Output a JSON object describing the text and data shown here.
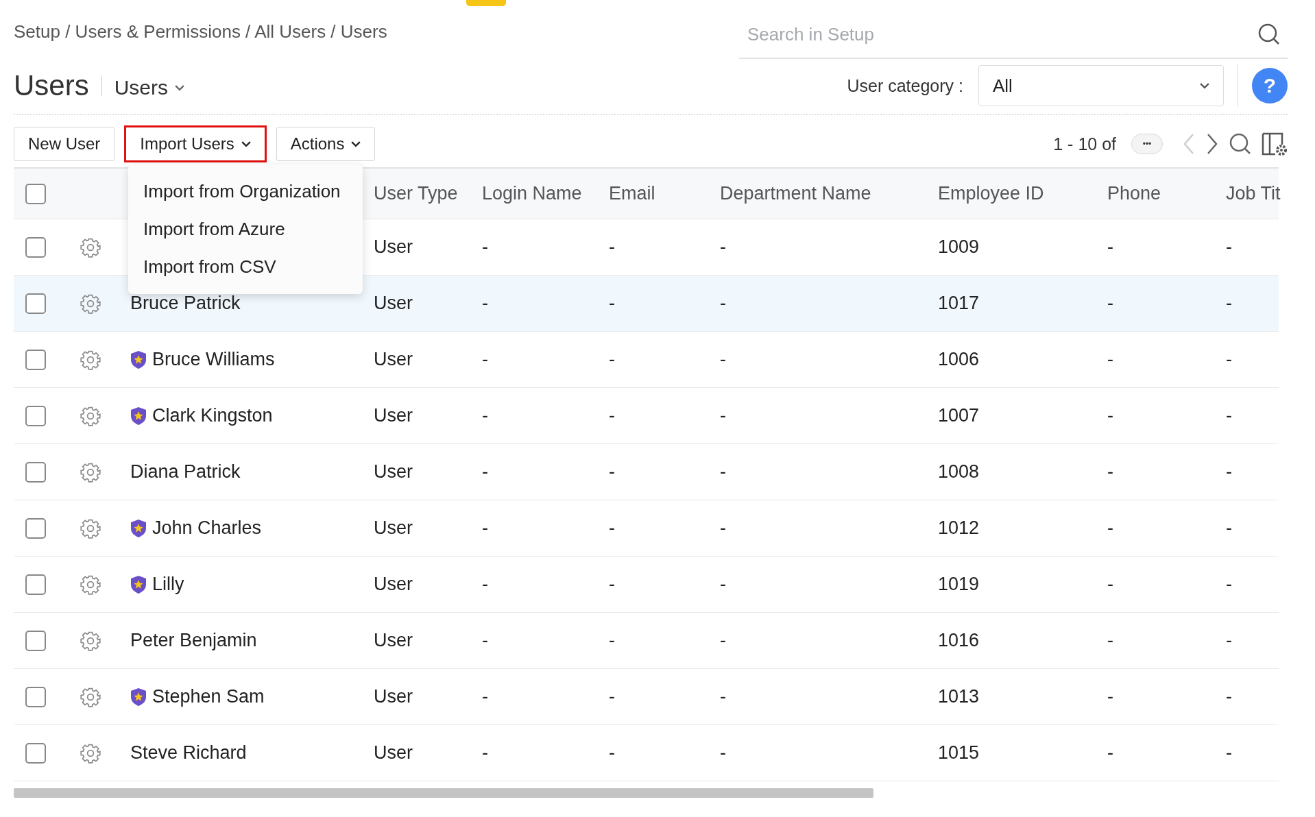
{
  "breadcrumb": "Setup / Users & Permissions / All Users / Users",
  "search": {
    "placeholder": "Search in Setup"
  },
  "title": "Users",
  "view": {
    "label": "Users"
  },
  "user_category": {
    "label": "User category :",
    "value": "All"
  },
  "help": {
    "label": "?"
  },
  "toolbar": {
    "buttons": [
      {
        "label": "New User",
        "highlighted": false,
        "dropdown": false
      },
      {
        "label": "Import Users",
        "highlighted": true,
        "dropdown": true
      },
      {
        "label": "Actions",
        "highlighted": false,
        "dropdown": true
      }
    ]
  },
  "pagination": {
    "range": "1 - 10 of",
    "more": "•••"
  },
  "import_menu": {
    "items": [
      "Import from Organization",
      "Import from Azure",
      "Import from CSV"
    ]
  },
  "table": {
    "select_all_checked": false,
    "columns": [
      "",
      "",
      "",
      "User Type",
      "Login Name",
      "Email",
      "Department Name",
      "Employee ID",
      "Phone",
      "Job Tit"
    ],
    "rows": [
      {
        "checked": false,
        "highlighted": false,
        "user_type": "User",
        "login_name": "-",
        "email": "-",
        "department": "-",
        "employee_id": "1009",
        "phone": "-",
        "job_title": "-"
      },
      {
        "checked": false,
        "highlighted": true,
        "badge": false,
        "name": "Bruce Patrick",
        "user_type": "User",
        "login_name": "-",
        "email": "-",
        "department": "-",
        "employee_id": "1017",
        "phone": "-",
        "job_title": "-"
      },
      {
        "checked": false,
        "highlighted": false,
        "badge": true,
        "name": "Bruce Williams",
        "user_type": "User",
        "login_name": "-",
        "email": "-",
        "department": "-",
        "employee_id": "1006",
        "phone": "-",
        "job_title": "-"
      },
      {
        "checked": false,
        "highlighted": false,
        "badge": true,
        "name": "Clark Kingston",
        "user_type": "User",
        "login_name": "-",
        "email": "-",
        "department": "-",
        "employee_id": "1007",
        "phone": "-",
        "job_title": "-"
      },
      {
        "checked": false,
        "highlighted": false,
        "badge": false,
        "name": "Diana Patrick",
        "user_type": "User",
        "login_name": "-",
        "email": "-",
        "department": "-",
        "employee_id": "1008",
        "phone": "-",
        "job_title": "-"
      },
      {
        "checked": false,
        "highlighted": false,
        "badge": true,
        "name": "John Charles",
        "user_type": "User",
        "login_name": "-",
        "email": "-",
        "department": "-",
        "employee_id": "1012",
        "phone": "-",
        "job_title": "-"
      },
      {
        "checked": false,
        "highlighted": false,
        "badge": true,
        "name": "Lilly",
        "user_type": "User",
        "login_name": "-",
        "email": "-",
        "department": "-",
        "employee_id": "1019",
        "phone": "-",
        "job_title": "-"
      },
      {
        "checked": false,
        "highlighted": false,
        "badge": false,
        "name": "Peter Benjamin",
        "user_type": "User",
        "login_name": "-",
        "email": "-",
        "department": "-",
        "employee_id": "1016",
        "phone": "-",
        "job_title": "-"
      },
      {
        "checked": false,
        "highlighted": false,
        "badge": true,
        "name": "Stephen Sam",
        "user_type": "User",
        "login_name": "-",
        "email": "-",
        "department": "-",
        "employee_id": "1013",
        "phone": "-",
        "job_title": "-"
      },
      {
        "checked": false,
        "highlighted": false,
        "badge": false,
        "name": "Steve Richard",
        "user_type": "User",
        "login_name": "-",
        "email": "-",
        "department": "-",
        "employee_id": "1015",
        "phone": "-",
        "job_title": "-"
      }
    ]
  }
}
